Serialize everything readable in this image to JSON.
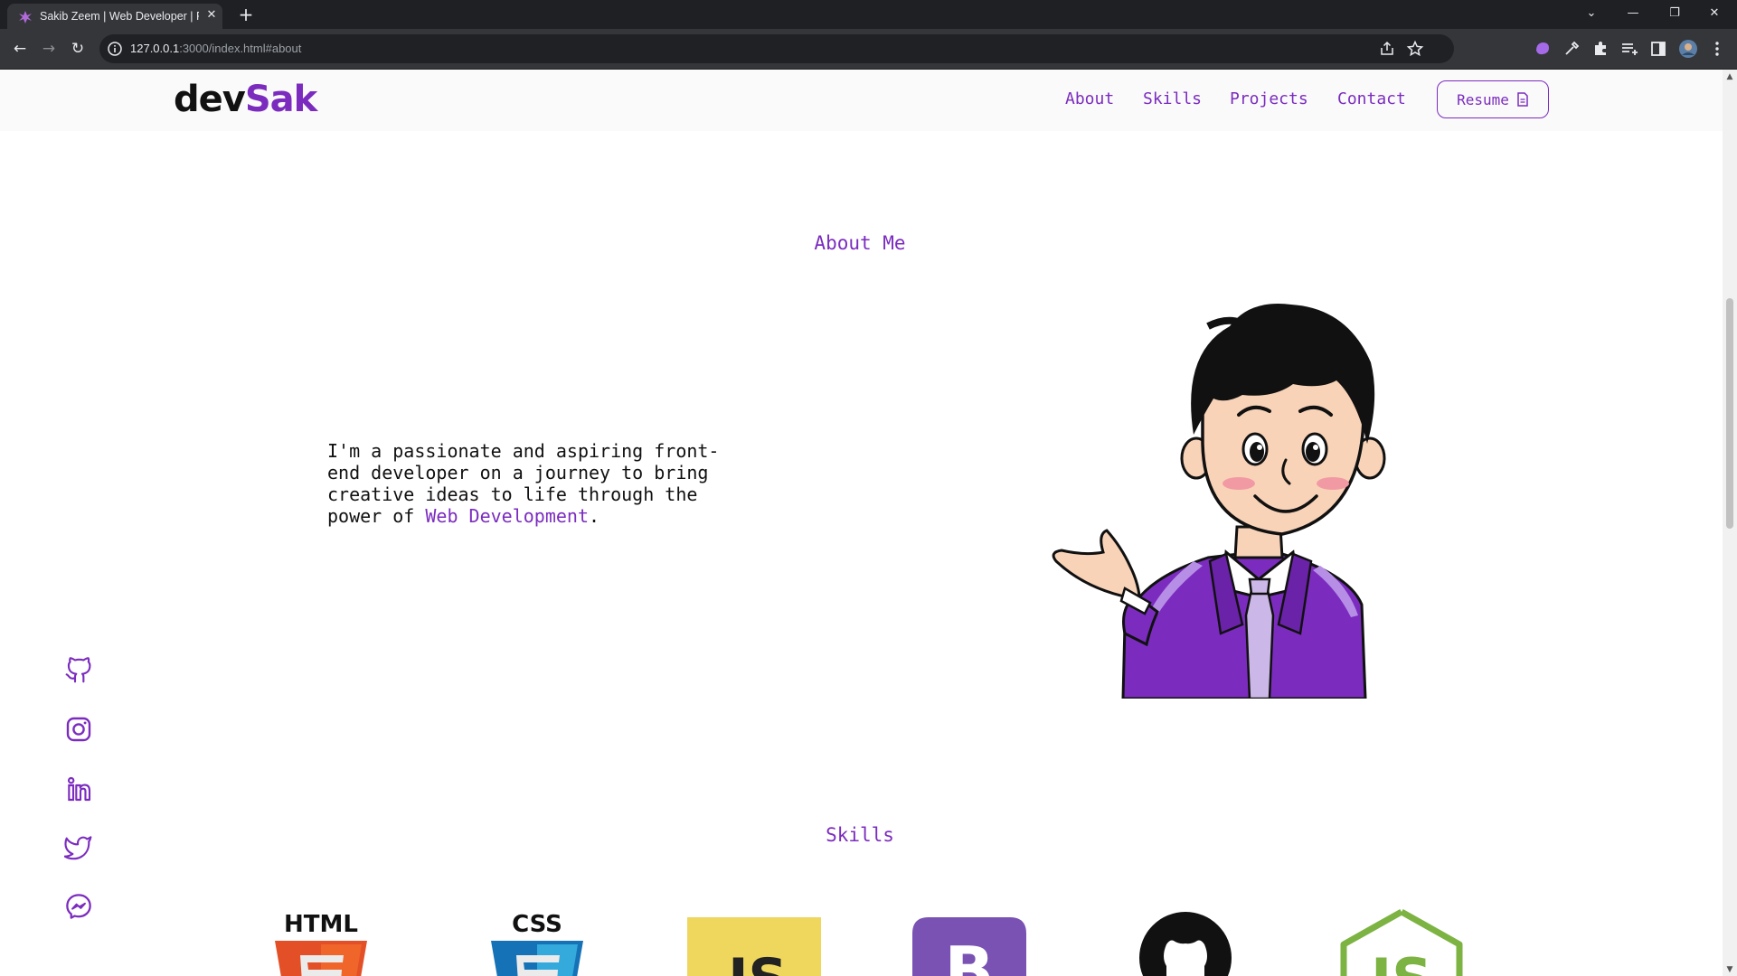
{
  "browser": {
    "tab_title": "Sakib Zeem | Web Developer | Fr",
    "url_host": "127.0.0.1",
    "url_rest": ":3000/index.html#about",
    "close_glyph": "✕",
    "new_tab_glyph": "+",
    "back_glyph": "←",
    "forward_glyph": "→",
    "reload_glyph": "↻",
    "min_glyph": "—",
    "restore_glyph": "❐",
    "win_close_glyph": "✕",
    "tab_search_glyph": "⌄"
  },
  "header": {
    "logo_part1": "dev",
    "logo_part2": "Sak",
    "nav": [
      "About",
      "Skills",
      "Projects",
      "Contact"
    ],
    "resume_label": "Resume"
  },
  "about": {
    "title": "About Me",
    "text_before": "I'm a passionate and aspiring front-end developer on a journey to bring creative ideas to life through the power of ",
    "text_highlight": "Web Development",
    "text_after": "."
  },
  "skills": {
    "title": "Skills",
    "items": [
      "HTML",
      "CSS",
      "JS",
      "Bootstrap",
      "GitHub",
      "Node.js"
    ]
  },
  "social": [
    "github-icon",
    "instagram-icon",
    "linkedin-icon",
    "twitter-icon",
    "messenger-icon"
  ],
  "colors": {
    "accent": "#7b2cbf",
    "chrome_dark": "#202124",
    "chrome": "#35363a"
  }
}
